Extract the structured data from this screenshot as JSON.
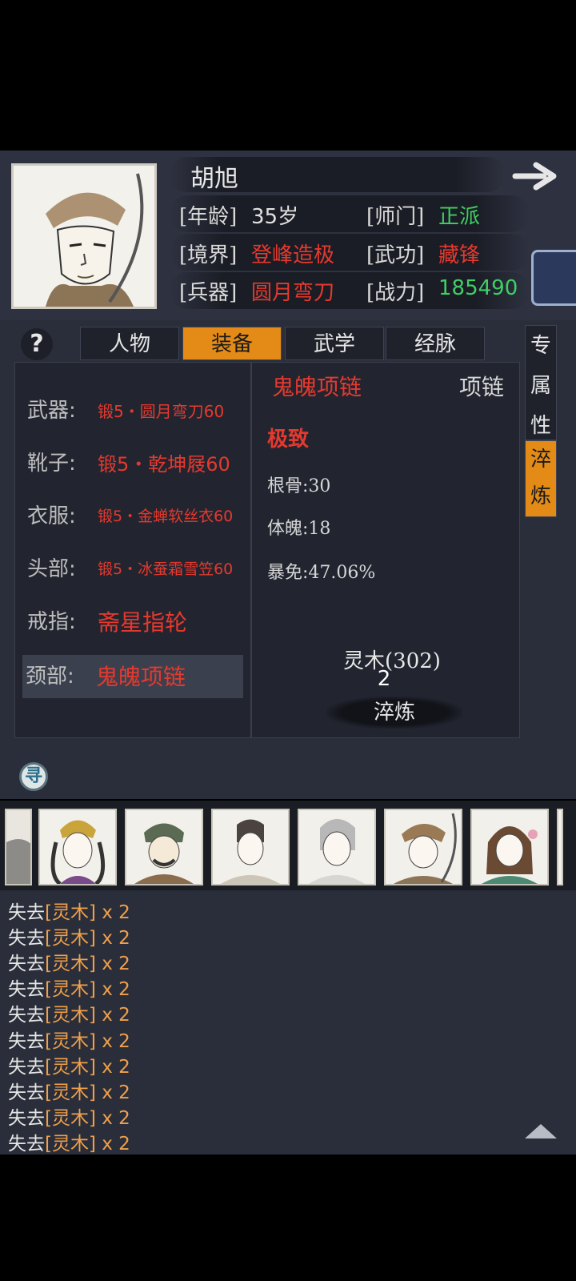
{
  "character": {
    "name": "胡旭",
    "rows": [
      {
        "label": "[年龄]",
        "value": "35岁",
        "color": "white",
        "label2": "[师门]",
        "value2": "正派",
        "color2": "green"
      },
      {
        "label": "[境界]",
        "value": "登峰造极",
        "color": "red",
        "label2": "[武功]",
        "value2": "藏锋",
        "color2": "red"
      },
      {
        "label": "[兵器]",
        "value": "圆月弯刀",
        "color": "red",
        "label2": "[战力]",
        "value2": "185490",
        "color2": "green"
      }
    ]
  },
  "help_symbol": "?",
  "tabs": [
    "人物",
    "装备",
    "武学",
    "经脉"
  ],
  "active_tab": "装备",
  "side_tabs": [
    {
      "label": "专\n属\n性",
      "active": false
    },
    {
      "label": "淬\n炼",
      "active": true
    }
  ],
  "equipment": [
    {
      "slot": "武器:",
      "item": "锻5・圆月弯刀60"
    },
    {
      "slot": "靴子:",
      "item": "锻5・乾坤屐60"
    },
    {
      "slot": "衣服:",
      "item": "锻5・金蝉软丝衣60"
    },
    {
      "slot": "头部:",
      "item": "锻5・冰蚕霜雪笠60"
    },
    {
      "slot": "戒指:",
      "item": "斋星指轮"
    },
    {
      "slot": "颈部:",
      "item": "鬼魄项链"
    }
  ],
  "detail": {
    "title": "鬼魄项链",
    "type": "项链",
    "grade": "极致",
    "stats": [
      "根骨:30",
      "体魄:18",
      "暴免:47.06%"
    ],
    "material": "灵木(302)",
    "material_count": "2",
    "forge_label": "淬炼"
  },
  "xun_icon": "寻",
  "log_lines": [
    {
      "prefix": "失去",
      "item": "[灵木]",
      "count": " x 2"
    },
    {
      "prefix": "失去",
      "item": "[灵木]",
      "count": " x 2"
    },
    {
      "prefix": "失去",
      "item": "[灵木]",
      "count": " x 2"
    },
    {
      "prefix": "失去",
      "item": "[灵木]",
      "count": " x 2"
    },
    {
      "prefix": "失去",
      "item": "[灵木]",
      "count": " x 2"
    },
    {
      "prefix": "失去",
      "item": "[灵木]",
      "count": " x 2"
    },
    {
      "prefix": "失去",
      "item": "[灵木]",
      "count": " x 2"
    },
    {
      "prefix": "失去",
      "item": "[灵木]",
      "count": " x 2"
    },
    {
      "prefix": "失去",
      "item": "[灵木]",
      "count": " x 2"
    },
    {
      "prefix": "失去",
      "item": "[灵木]",
      "count": " x 2"
    }
  ],
  "colors": {
    "accent": "#e38b16",
    "red": "#e5392e",
    "green": "#3fcf64",
    "panel": "#2a2e3a"
  }
}
